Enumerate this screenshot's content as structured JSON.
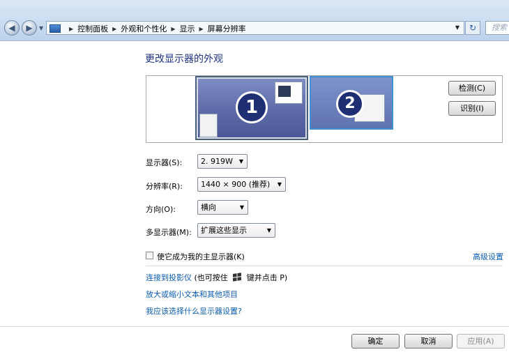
{
  "addressbar": {
    "breadcrumbs": [
      "控制面板",
      "外观和个性化",
      "显示",
      "屏幕分辨率"
    ],
    "search_placeholder": "搜索"
  },
  "heading": "更改显示器的外观",
  "preview": {
    "monitor1_number": "1",
    "monitor2_number": "2",
    "detect_button": "检测(C)",
    "identify_button": "识别(I)"
  },
  "form": {
    "display_label": "显示器(S):",
    "display_value": "2. 919W",
    "resolution_label": "分辨率(R):",
    "resolution_value": "1440 × 900 (推荐)",
    "orientation_label": "方向(O):",
    "orientation_value": "横向",
    "multi_label": "多显示器(M):",
    "multi_value": "扩展这些显示"
  },
  "main_display_checkbox": {
    "label": "使它成为我的主显示器(K)",
    "checked": false
  },
  "advanced_link": "高级设置",
  "links": {
    "projector": "连接到投影仪",
    "projector_hint_pre": "(也可按住",
    "projector_hint_post": "键并点击 P)",
    "text_size": "放大或缩小文本和其他项目",
    "which_settings": "我应该选择什么显示器设置?"
  },
  "footer": {
    "ok": "确定",
    "cancel": "取消",
    "apply": "应用(A)"
  }
}
